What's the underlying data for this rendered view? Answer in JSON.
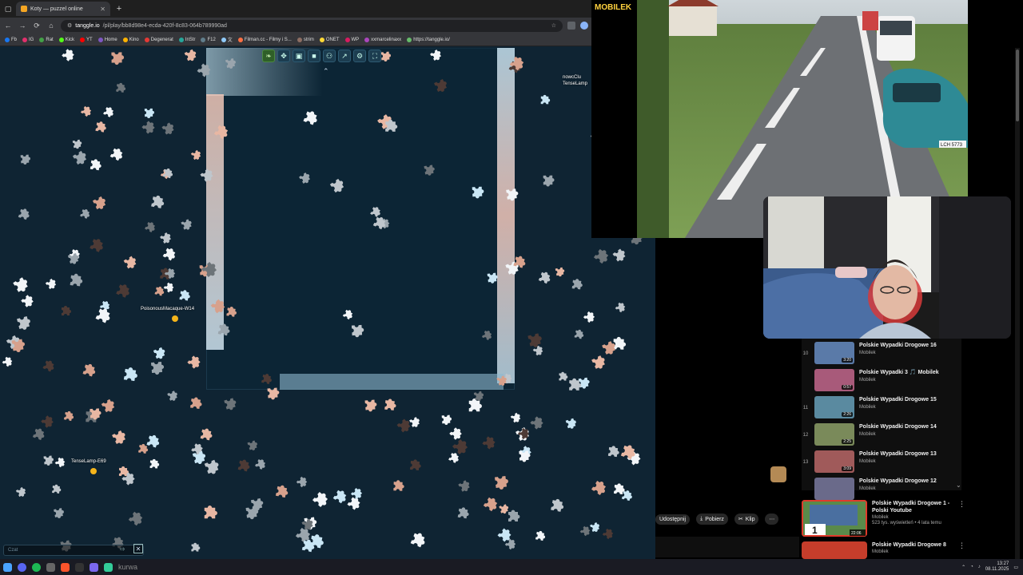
{
  "browser": {
    "tab_title": "Koty — puzzel online",
    "url_host": "tanggle.io",
    "url_path": "/pl/play/bb8d98e4-ecda-420f-8c83-064b789990ad",
    "bookmarks": [
      {
        "label": "Fb",
        "color": "#1877f2"
      },
      {
        "label": "IG",
        "color": "#e1306c"
      },
      {
        "label": "Rat",
        "color": "#43a047"
      },
      {
        "label": "Kick",
        "color": "#53fc18"
      },
      {
        "label": "YT",
        "color": "#ff0000"
      },
      {
        "label": "Home",
        "color": "#7e57c2"
      },
      {
        "label": "Kino",
        "color": "#ffb300"
      },
      {
        "label": "Degenerat",
        "color": "#e53935"
      },
      {
        "label": "InStr",
        "color": "#26a69a"
      },
      {
        "label": "F12",
        "color": "#607d8b"
      },
      {
        "label": "文",
        "color": "#90caf9"
      },
      {
        "label": "Filman.cc - Filmy i S...",
        "color": "#ff7043"
      },
      {
        "label": "strim",
        "color": "#8d6e63"
      },
      {
        "label": "ONET",
        "color": "#fdd835"
      },
      {
        "label": "WP",
        "color": "#d81b60"
      },
      {
        "label": "xxmarcelinaxx",
        "color": "#ab47bc"
      },
      {
        "label": "https://tanggle.io/",
        "color": "#66bb6a"
      }
    ]
  },
  "puzzle": {
    "cursors": [
      {
        "label": "PoisonousMacaque-W14",
        "color": "#f5b51b"
      },
      {
        "label": "TenseLamp-E69",
        "color": "#f5b51b"
      },
      {
        "label": "TenseLamp",
        "color": "#f5b51b"
      },
      {
        "label": "nowcClu",
        "color": "#f5b51b"
      }
    ],
    "chat_placeholder": "Czat"
  },
  "stream": {
    "logo": "MOBILEK",
    "plate": "LCH 5773"
  },
  "playlist": [
    {
      "idx": "10",
      "title": "Polskie Wypadki Drogowe 16",
      "channel": "Mobilek",
      "duration": "3:20",
      "thumb": "#5a7aa8"
    },
    {
      "idx": "",
      "title": "Polskie Wypadki 3 🎵 Mobilek",
      "channel": "Mobilek",
      "duration": "0:57",
      "thumb": "#a85a7a"
    },
    {
      "idx": "11",
      "title": "Polskie Wypadki Drogowe 15",
      "channel": "Mobilek",
      "duration": "2:26",
      "thumb": "#5a8aa0"
    },
    {
      "idx": "12",
      "title": "Polskie Wypadki Drogowe 14",
      "channel": "Mobilek",
      "duration": "2:25",
      "thumb": "#7a8a5a"
    },
    {
      "idx": "13",
      "title": "Polskie Wypadki Drogowe 13",
      "channel": "Mobilek",
      "duration": "3:09",
      "thumb": "#a05a5a"
    },
    {
      "idx": "",
      "title": "Polskie Wypadki Drogowe 12",
      "channel": "Mobilek",
      "duration": "",
      "thumb": "#6a6a8a"
    }
  ],
  "actions": {
    "share": "Udostępnij",
    "download": "Pobierz",
    "clip": "Klip"
  },
  "recommendations": [
    {
      "title": "Polskie Wypadki Drogowe 1 - Polski Youtube",
      "channel": "Mobilek",
      "meta": "523 tys. wyświetleń • 4 lata temu",
      "duration": "22:06",
      "badge": "1"
    },
    {
      "title": "Polskie Wypadki Drogowe 8",
      "channel": "Mobilek",
      "meta": "",
      "duration": "",
      "badge": ""
    }
  ],
  "taskbar": {
    "search_text": "kurwa",
    "time": "13:27",
    "date": "08.11.2025"
  }
}
